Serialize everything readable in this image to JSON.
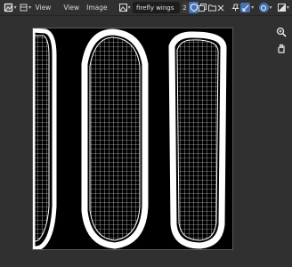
{
  "header": {
    "editor_type_icon": "image-editor-icon",
    "menu": {
      "view": "View",
      "view2": "View",
      "image": "Image"
    },
    "image_name": "firefly wings",
    "user_count": "2"
  },
  "colors": {
    "accent": "#4772b3",
    "panel": "#303030",
    "canvas": "#000000",
    "wire": "#ffffff"
  }
}
